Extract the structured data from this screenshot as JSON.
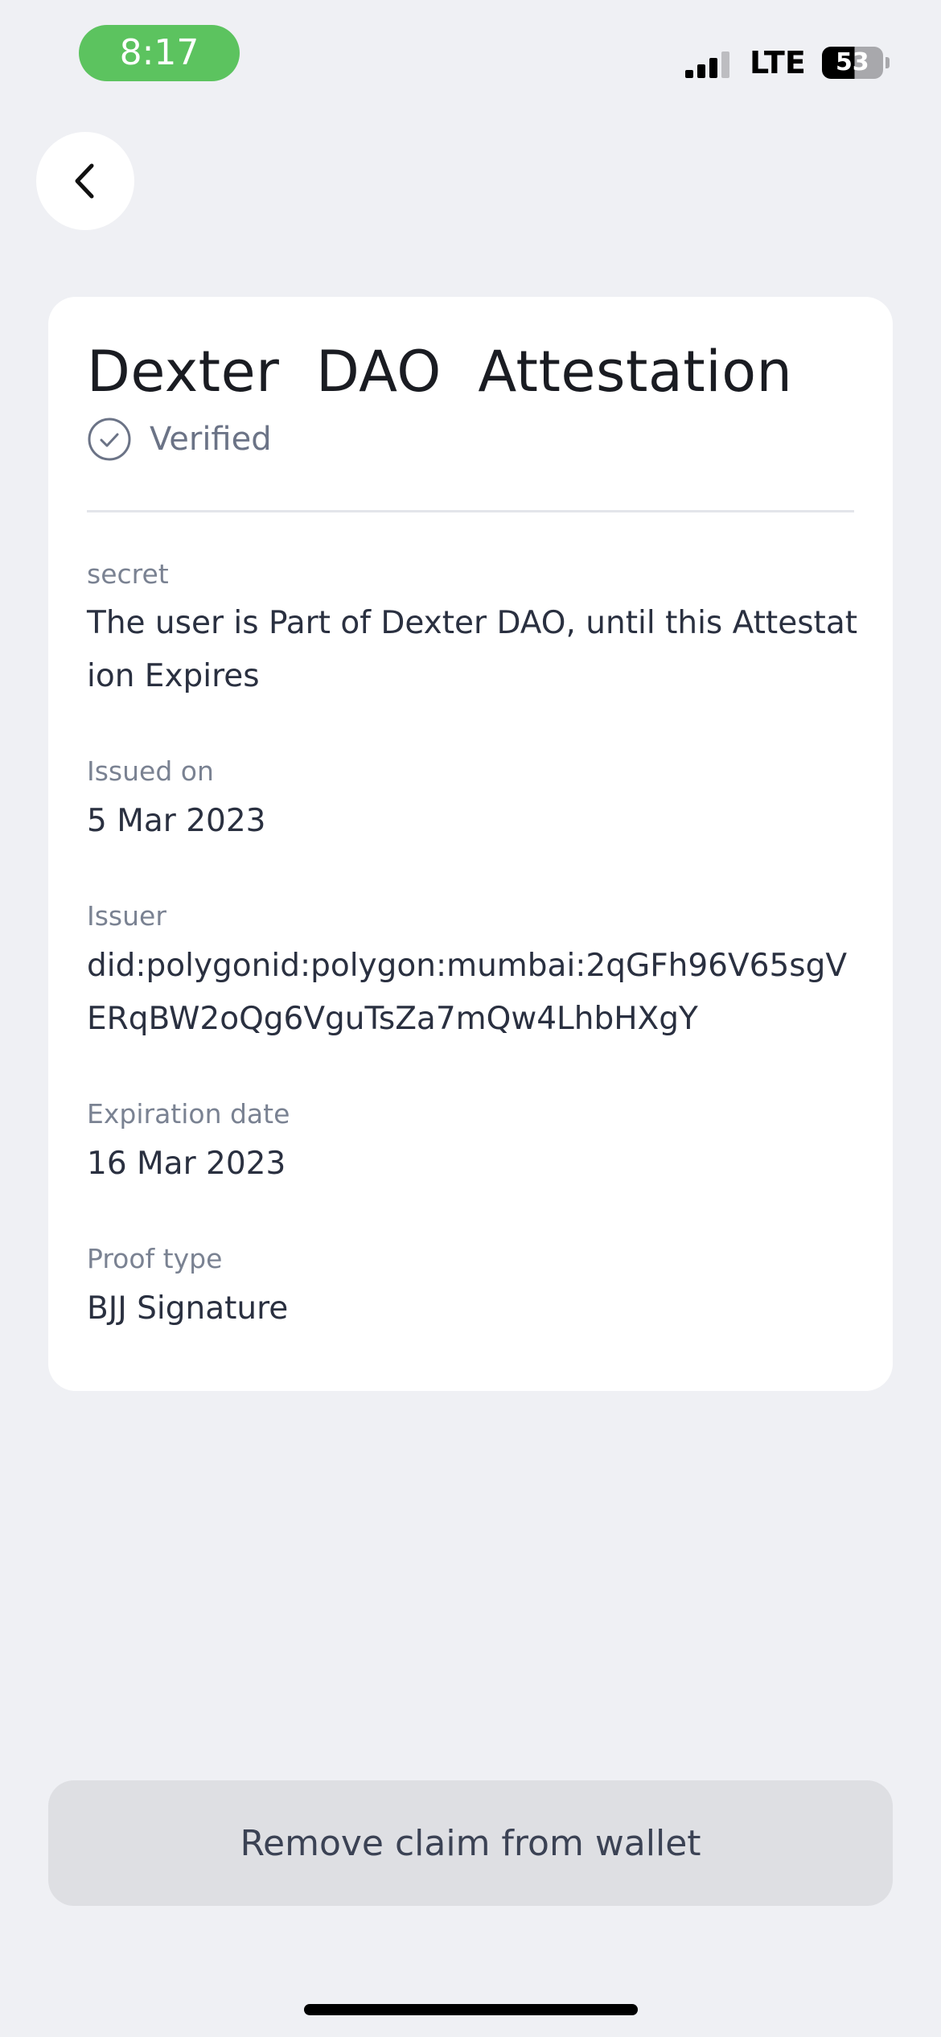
{
  "status_bar": {
    "time": "8:17",
    "network": "LTE",
    "battery_level": "53",
    "battery_fraction": 0.53
  },
  "nav": {
    "back_icon": "chevron-left-icon"
  },
  "credential": {
    "title": "Dexter  DAO  Attestation",
    "status": "Verified",
    "status_icon": "check-circle-icon",
    "fields": [
      {
        "label": "secret",
        "value": "The user is Part of Dexter DAO, until this Attestation Expires"
      },
      {
        "label": "Issued on",
        "value": "5 Mar 2023"
      },
      {
        "label": "Issuer",
        "value": "did:polygonid:polygon:mumbai:2qGFh96V65sgVERqBW2oQg6VguTsZa7mQw4LhbHXgY"
      },
      {
        "label": "Expiration date",
        "value": "16 Mar 2023"
      },
      {
        "label": "Proof type",
        "value": "BJJ Signature"
      }
    ]
  },
  "actions": {
    "remove_label": "Remove claim from wallet"
  },
  "colors": {
    "background": "#EFF0F4",
    "card": "#FFFFFF",
    "status_time_pill": "#5CC35F",
    "button": "#DEDFE3",
    "secondary_text": "#7A8292"
  }
}
